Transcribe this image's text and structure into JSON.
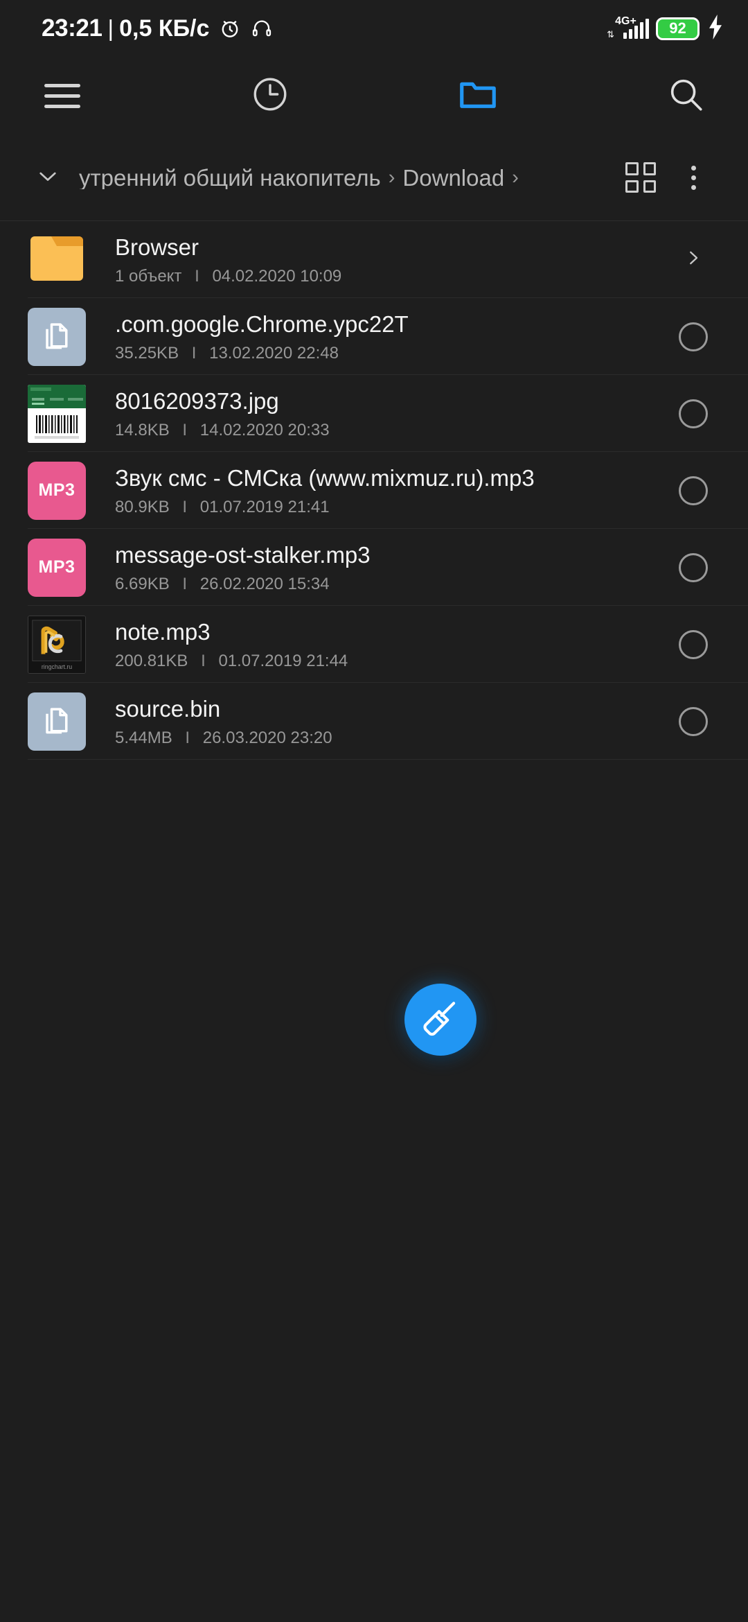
{
  "status_bar": {
    "time": "23:21",
    "separator": "|",
    "network_speed": "0,5 КБ/c",
    "alarm_icon": "alarm-clock-icon",
    "headphones_icon": "headphones-icon",
    "network_type": "4G+",
    "signal_icon": "signal-bars-icon",
    "battery_level": "92",
    "charging_icon": "lightning-bolt-icon",
    "battery_color": "#33cc44"
  },
  "toolbar": {
    "menu_icon": "hamburger-menu-icon",
    "recent_icon": "clock-icon",
    "files_icon": "folder-icon",
    "search_icon": "search-icon",
    "active_tab": "files",
    "accent_color": "#2196f3"
  },
  "breadcrumb": {
    "collapse_icon": "chevron-down-icon",
    "segments": [
      "утренний общий накопитель",
      "Download"
    ],
    "separator": "›",
    "trailing_separator": "›",
    "grid_view_icon": "grid-view-icon",
    "overflow_icon": "more-vertical-icon"
  },
  "files": [
    {
      "name": "Browser",
      "size": "1 объект",
      "divider": "I",
      "date": "04.02.2020 10:09",
      "icon": "folder-icon",
      "kind": "folder",
      "trailing": "chevron-right-icon"
    },
    {
      "name": ".com.google.Chrome.ypc22T",
      "size": "35.25KB",
      "divider": "I",
      "date": "13.02.2020 22:48",
      "icon": "document-icon",
      "kind": "doc",
      "trailing": "select-radio"
    },
    {
      "name": "8016209373.jpg",
      "size": "14.8KB",
      "divider": "I",
      "date": "14.02.2020 20:33",
      "icon": "image-thumbnail",
      "kind": "img",
      "trailing": "select-radio"
    },
    {
      "name": "Звук смс - СМСка (www.mixmuz.ru).mp3",
      "size": "80.9KB",
      "divider": "I",
      "date": "01.07.2019 21:41",
      "icon": "mp3-icon",
      "kind": "mp3",
      "badge": "MP3",
      "trailing": "select-radio"
    },
    {
      "name": "message-ost-stalker.mp3",
      "size": "6.69KB",
      "divider": "I",
      "date": "26.02.2020 15:34",
      "icon": "mp3-icon",
      "kind": "mp3",
      "badge": "MP3",
      "trailing": "select-radio"
    },
    {
      "name": "note.mp3",
      "size": "200.81KB",
      "divider": "I",
      "date": "01.07.2019 21:44",
      "icon": "album-art-thumbnail",
      "kind": "art",
      "trailing": "select-radio"
    },
    {
      "name": "source.bin",
      "size": "5.44MB",
      "divider": "I",
      "date": "26.03.2020 23:20",
      "icon": "document-icon",
      "kind": "doc",
      "trailing": "select-radio"
    }
  ],
  "fab": {
    "icon": "cleaner-broom-icon",
    "color": "#2196f3"
  },
  "colors": {
    "background": "#1e1e1e",
    "folder": "#fbbf55",
    "doc_tile": "#a6b8cb",
    "mp3_tile": "#e8598f",
    "accent": "#2196f3"
  }
}
